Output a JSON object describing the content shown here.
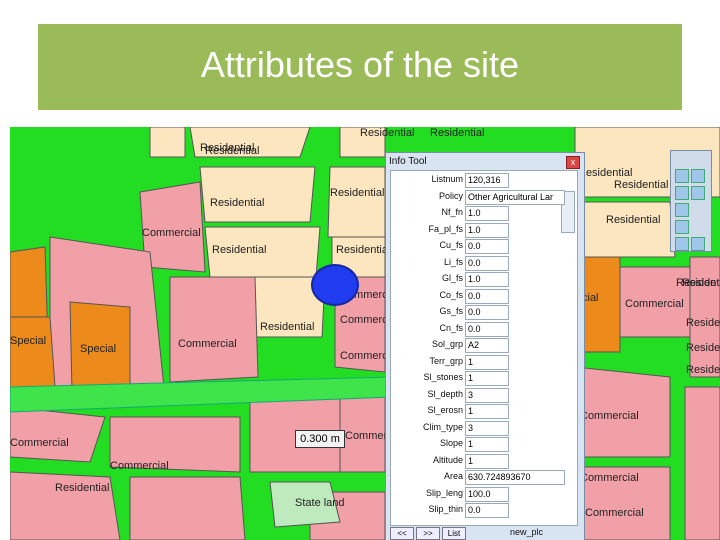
{
  "title": "Attributes of the site",
  "scale": "0.300 m",
  "map_labels": [
    "Residential",
    "Residential",
    "Residential",
    "Residential",
    "Residential",
    "Residential",
    "Commercial",
    "Residential",
    "Residential",
    "Commercial",
    "Commercial",
    "Special",
    "Special",
    "Commercial",
    "Residential",
    "Commercial",
    "Commercial",
    "Commercial",
    "Commercial",
    "Residential",
    "State land",
    "Residential",
    "Residential",
    "Residential",
    "Commercial",
    "Reside",
    "Reside",
    "Reside",
    "Reside",
    "Commercial",
    "Commercial",
    "Commercial",
    "cial",
    "Resident"
  ],
  "info_tool": {
    "title": "Info Tool",
    "close": "x",
    "fields": [
      {
        "key": "Listnum",
        "value": "120,316"
      },
      {
        "key": "Policy",
        "value": "Other Agricultural Lar"
      },
      {
        "key": "Nf_fn",
        "value": "1.0"
      },
      {
        "key": "Fa_pl_fs",
        "value": "1.0"
      },
      {
        "key": "Cu_fs",
        "value": "0.0"
      },
      {
        "key": "Li_fs",
        "value": "0.0"
      },
      {
        "key": "Gl_fs",
        "value": "1.0"
      },
      {
        "key": "Co_fs",
        "value": "0.0"
      },
      {
        "key": "Gs_fs",
        "value": "0.0"
      },
      {
        "key": "Cn_fs",
        "value": "0.0"
      },
      {
        "key": "Sol_grp",
        "value": "A2"
      },
      {
        "key": "Terr_grp",
        "value": "1"
      },
      {
        "key": "Sl_stones",
        "value": "1"
      },
      {
        "key": "Sl_depth",
        "value": "3"
      },
      {
        "key": "Sl_erosn",
        "value": "1"
      },
      {
        "key": "Clim_type",
        "value": "3"
      },
      {
        "key": "Slope",
        "value": "1"
      },
      {
        "key": "Altitude",
        "value": "1"
      },
      {
        "key": "Area",
        "value": "630.724893670"
      },
      {
        "key": "Slip_leng",
        "value": "100.0"
      },
      {
        "key": "Slip_thin",
        "value": "0.0"
      }
    ],
    "btn_prev": "<<",
    "btn_next": ">>",
    "btn_list": "List",
    "footer_text": "new_plc"
  }
}
